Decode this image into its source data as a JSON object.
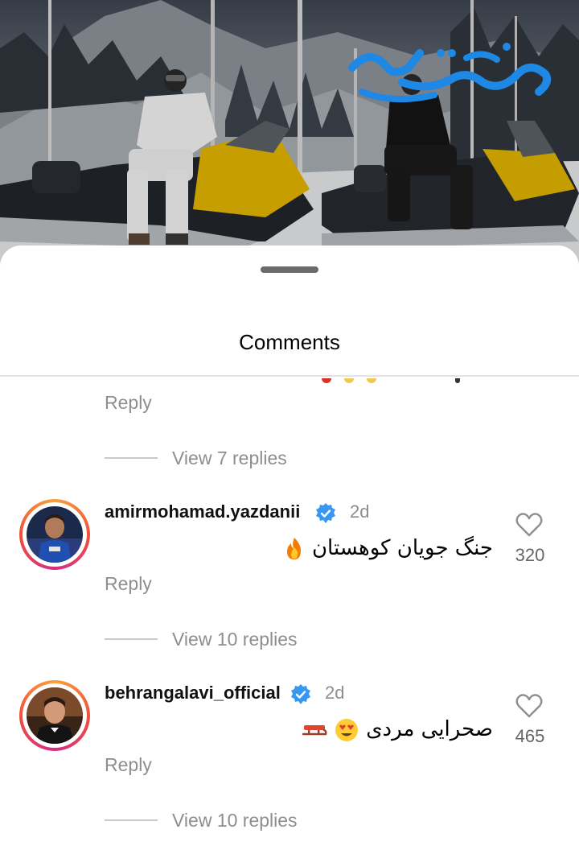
{
  "background": {
    "brand_logo_text": "وقت صبح",
    "brand_color": "#1e88e5"
  },
  "sheet": {
    "title": "Comments"
  },
  "thread_top": {
    "reply_label": "Reply",
    "view_replies": "View 7 replies"
  },
  "comments": [
    {
      "username": "amirmohamad.yazdanii",
      "verified": true,
      "time": "2d",
      "text": "جنگ جویان کوهستان",
      "emoji": "fire",
      "likes": "320",
      "reply_label": "Reply",
      "view_replies": "View 10 replies"
    },
    {
      "username": "behrangalavi_official",
      "verified": true,
      "time": "2d",
      "text": "صحرایی مردی",
      "emoji": "heart-eyes + sled",
      "likes": "465",
      "reply_label": "Reply",
      "view_replies": "View 10 replies"
    }
  ],
  "colors": {
    "verified_badge": "#3897f0",
    "secondary_text": "#8e8e8e",
    "story_ring": "#d52d86"
  }
}
